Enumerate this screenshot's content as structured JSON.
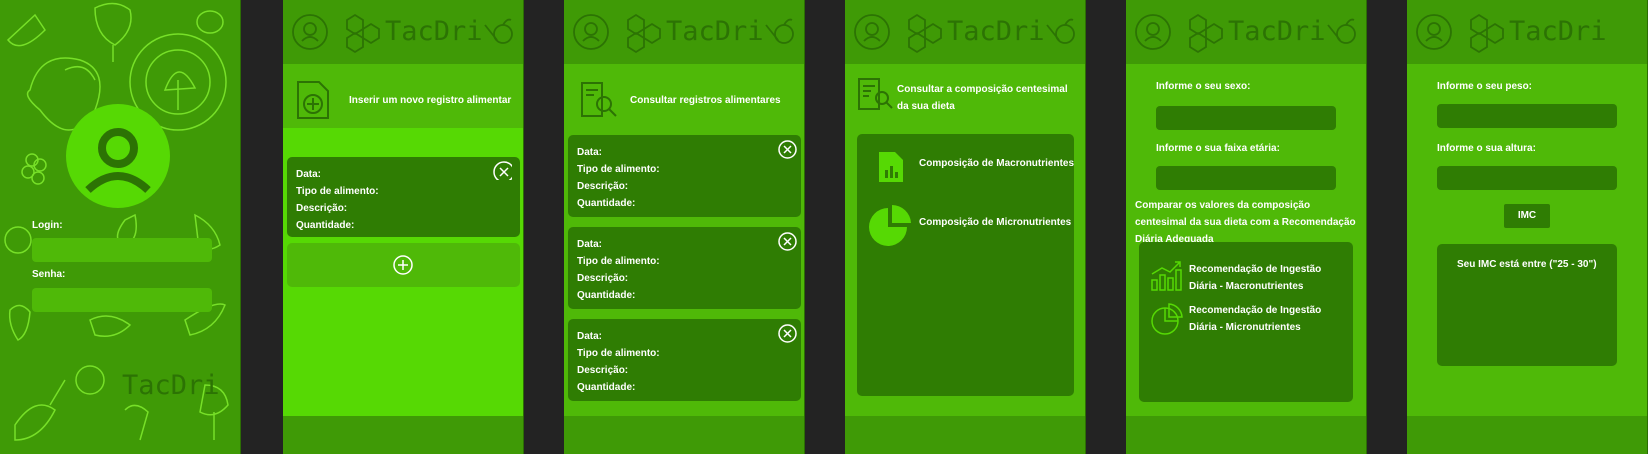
{
  "brand": "TacDri",
  "login": {
    "brand": "TacDri",
    "login_label": "Login:",
    "password_label": "Senha:"
  },
  "insert": {
    "title": "Inserir um novo registro alimentar",
    "card": {
      "data": "Data:",
      "tipo": "Tipo de alimento:",
      "descricao": "Descrição:",
      "quantidade": "Quantidade:"
    }
  },
  "consult": {
    "title": "Consultar  registros alimentares",
    "cards": [
      {
        "data": "Data:",
        "tipo": "Tipo de alimento:",
        "descricao": "Descrição:",
        "quantidade": "Quantidade:"
      },
      {
        "data": "Data:",
        "tipo": "Tipo de alimento:",
        "descricao": "Descrição:",
        "quantidade": "Quantidade:"
      },
      {
        "data": "Data:",
        "tipo": "Tipo de alimento:",
        "descricao": "Descrição:",
        "quantidade": "Quantidade:"
      }
    ]
  },
  "composition": {
    "title": "Consultar a composição centesimal da sua dieta",
    "macro": "Composição de Macronutrientes",
    "micro": "Composição de Micronutrientes"
  },
  "recommend": {
    "sex_label": "Informe o seu sexo:",
    "age_label": "Informe o sua faixa etária:",
    "compare_text": "Comparar os valores da composição centesimal da sua dieta com a Recomendação Diária Adequada",
    "macro": "Recomendação de Ingestão Diária - Macronutrientes",
    "micro": "Recomendação de Ingestão Diária - Micronutrientes"
  },
  "imc": {
    "weight_label": "Informe o seu peso:",
    "height_label": "Informe o sua altura:",
    "button": "IMC",
    "result": "Seu IMC está entre (\"25 - 30\")"
  },
  "colors": {
    "screen_bg": "#3f9a06",
    "body_bg": "#4fb908",
    "panel": "#2f7d03",
    "content": "#56d904",
    "line": "#77e028"
  },
  "icons": [
    "profile-icon",
    "molecule-icon",
    "fruit-icon",
    "document-plus-icon",
    "search-document-icon",
    "close-icon",
    "plus-icon",
    "chart-document-icon",
    "pie-chart-icon",
    "bar-chart-icon"
  ]
}
